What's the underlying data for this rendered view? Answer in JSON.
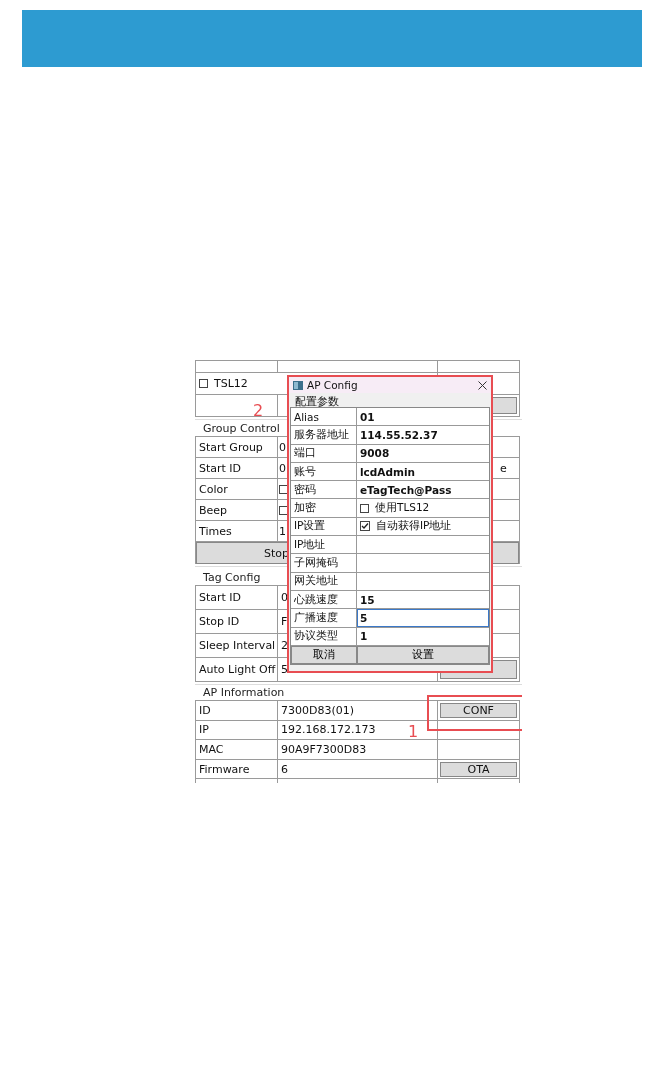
{
  "app": {
    "top_rows": [
      {
        "kind": "checkbox",
        "label": "TSL12",
        "checked": false
      },
      {
        "kind": "button"
      }
    ],
    "group_control": {
      "title": "Group Control",
      "rows": [
        {
          "kind": "text",
          "label": "Start Group",
          "value": "0"
        },
        {
          "kind": "text",
          "label": "Start ID",
          "value": "0",
          "side": "e"
        },
        {
          "kind": "checkbox",
          "label": "Color",
          "checked": false
        },
        {
          "kind": "checkbox",
          "label": "Beep",
          "checked": false
        },
        {
          "kind": "text",
          "label": "Times",
          "value": "1"
        }
      ],
      "button": "Stop"
    },
    "tag_config": {
      "title": "Tag Config",
      "rows": [
        {
          "label": "Start ID",
          "value": "0"
        },
        {
          "label": "Stop ID",
          "value": "F"
        },
        {
          "label": "Sleep Interval",
          "value": "2"
        },
        {
          "label": "Auto Light Off",
          "value": "5"
        }
      ]
    },
    "ap_information": {
      "title": "AP Information",
      "rows": [
        {
          "label": "ID",
          "value": "7300D83(01)",
          "button": "CONF"
        },
        {
          "label": "IP",
          "value": "192.168.172.173"
        },
        {
          "label": "MAC",
          "value": "90A9F7300D83"
        },
        {
          "label": "Firmware",
          "value": "6",
          "button": "OTA"
        }
      ]
    }
  },
  "dialog": {
    "title": "AP Config",
    "group": "配置参数",
    "fields": [
      {
        "kind": "text",
        "label": "Alias",
        "value": "01",
        "focused": false
      },
      {
        "kind": "text",
        "label": "服务器地址",
        "value": "114.55.52.37",
        "focused": false
      },
      {
        "kind": "text",
        "label": "端口",
        "value": "9008",
        "focused": false
      },
      {
        "kind": "text",
        "label": "账号",
        "value": "lcdAdmin",
        "focused": false
      },
      {
        "kind": "text",
        "label": "密码",
        "value": "eTagTech@Pass",
        "focused": false
      },
      {
        "kind": "checkbox",
        "label": "加密",
        "option": "使用TLS12",
        "checked": false
      },
      {
        "kind": "checkbox",
        "label": "IP设置",
        "option": "自动获得IP地址",
        "checked": true
      },
      {
        "kind": "text",
        "label": "IP地址",
        "focused": false
      },
      {
        "kind": "text",
        "label": "子网掩码",
        "focused": false
      },
      {
        "kind": "text",
        "label": "网关地址",
        "focused": false
      },
      {
        "kind": "text",
        "label": "心跳速度",
        "value": "15",
        "focused": false
      },
      {
        "kind": "text",
        "label": "广播速度",
        "value": "5",
        "focused": true
      },
      {
        "kind": "text",
        "label": "协议类型",
        "value": "1",
        "focused": false
      }
    ],
    "buttons": [
      "取消",
      "设置"
    ]
  },
  "annotations": [
    "1",
    "2"
  ]
}
